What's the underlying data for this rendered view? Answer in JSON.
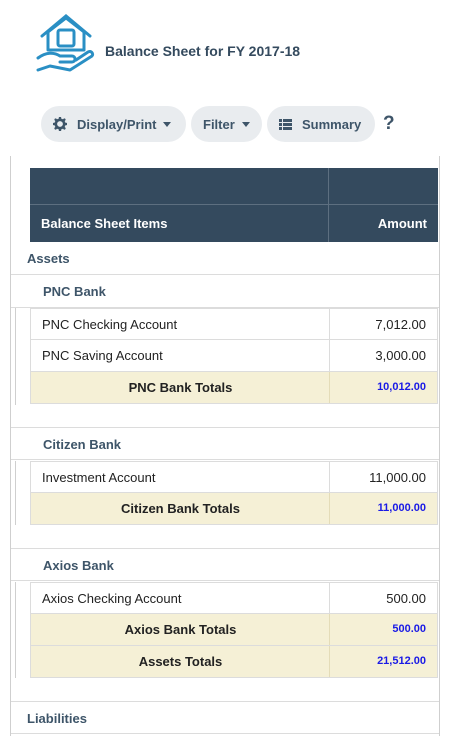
{
  "header": {
    "title": "Balance Sheet for FY 2017-18",
    "logo_icon": "house-in-hand-icon"
  },
  "toolbar": {
    "display_print": "Display/Print",
    "filter": "Filter",
    "summary": "Summary",
    "help": "?"
  },
  "table": {
    "col_items": "Balance Sheet Items",
    "col_amount": "Amount"
  },
  "assets": {
    "label": "Assets",
    "groups": [
      {
        "name": "PNC Bank",
        "rows": [
          {
            "name": "PNC Checking Account",
            "amount": "7,012.00"
          },
          {
            "name": "PNC Saving Account",
            "amount": "3,000.00"
          }
        ],
        "total_label": "PNC Bank Totals",
        "total": "10,012.00"
      },
      {
        "name": "Citizen Bank",
        "rows": [
          {
            "name": "Investment Account",
            "amount": "11,000.00"
          }
        ],
        "total_label": "Citizen Bank Totals",
        "total": "11,000.00"
      },
      {
        "name": "Axios Bank",
        "rows": [
          {
            "name": "Axios Checking Account",
            "amount": "500.00"
          }
        ],
        "total_label": "Axios Bank Totals",
        "total": "500.00"
      }
    ],
    "total_label": "Assets Totals",
    "total": "21,512.00"
  },
  "liabilities": {
    "label": "Liabilities"
  },
  "colors": {
    "header_bg": "#344a5e",
    "total_bg": "#f5f0d6",
    "total_amount": "#1a1ae6",
    "logo": "#2a8fc4"
  }
}
